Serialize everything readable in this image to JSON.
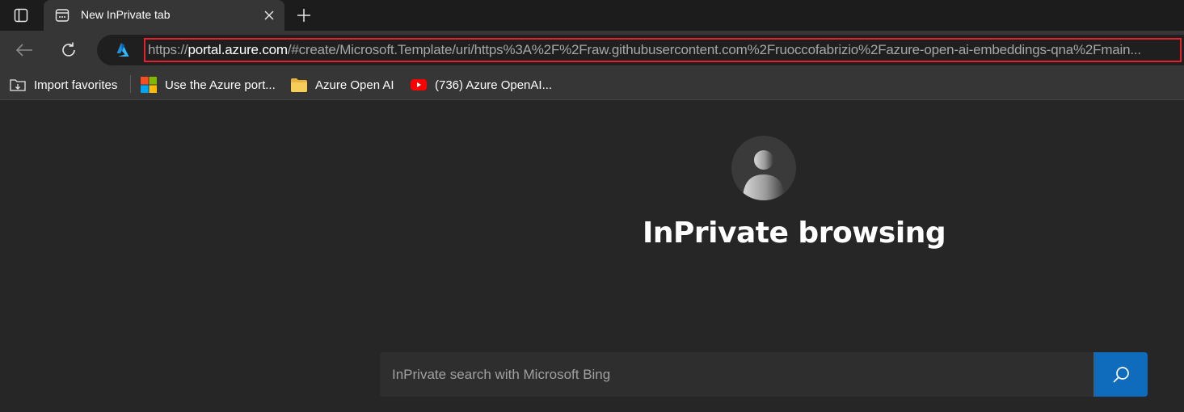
{
  "tab": {
    "title": "New InPrivate tab"
  },
  "address": {
    "url_prefix": "https://",
    "url_host": "portal.azure.com",
    "url_rest": "/#create/Microsoft.Template/uri/https%3A%2F%2Fraw.githubusercontent.com%2Fruoccofabrizio%2Fazure-open-ai-embeddings-qna%2Fmain..."
  },
  "favorites": [
    {
      "label": "Import favorites",
      "icon": "import-favorites-icon"
    },
    {
      "label": "Use the Azure port...",
      "icon": "microsoft-logo-icon"
    },
    {
      "label": "Azure Open AI",
      "icon": "folder-icon"
    },
    {
      "label": "(736) Azure OpenAI...",
      "icon": "youtube-icon"
    }
  ],
  "page": {
    "heading": "InPrivate browsing",
    "search_placeholder": "InPrivate search with Microsoft Bing"
  },
  "colors": {
    "accent": "#0f6cbd",
    "highlight_border": "#e3202b"
  }
}
